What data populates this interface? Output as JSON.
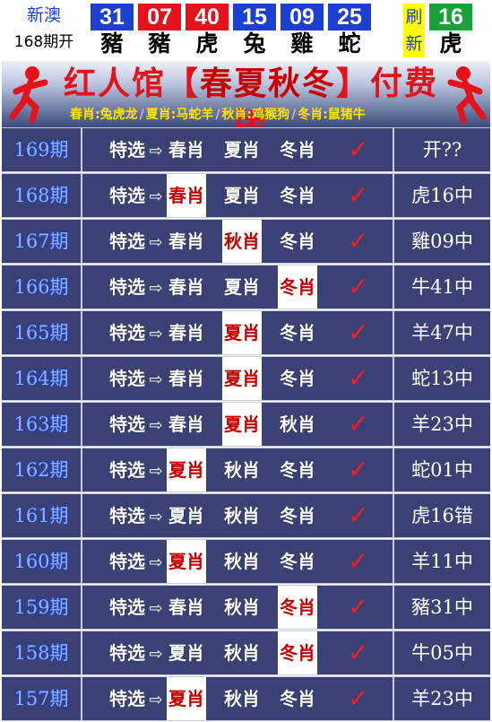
{
  "draw": {
    "lottery": "新澳",
    "period_label": "168期开",
    "refresh": [
      "刷",
      "新"
    ],
    "balls": [
      {
        "num": "31",
        "zodiac": "豬",
        "color": "#1d3fcf"
      },
      {
        "num": "07",
        "zodiac": "豬",
        "color": "#e3121b"
      },
      {
        "num": "40",
        "zodiac": "虎",
        "color": "#e3121b"
      },
      {
        "num": "15",
        "zodiac": "兔",
        "color": "#1d3fcf"
      },
      {
        "num": "09",
        "zodiac": "雞",
        "color": "#1d3fcf"
      },
      {
        "num": "25",
        "zodiac": "蛇",
        "color": "#1d3fcf"
      },
      {
        "num": "16",
        "zodiac": "虎",
        "color": "#18a238"
      }
    ]
  },
  "banner": {
    "title_pre": "红人馆【",
    "title_mid": "春夏秋冬",
    "title_post": "】付费版",
    "groups": [
      "春肖:兔虎龙",
      "夏肖:马蛇羊",
      "秋肖:鸡猴狗",
      "冬肖:鼠猪牛"
    ],
    "separator": "/"
  },
  "table": {
    "prefix": "特选",
    "arrow": "⇨",
    "check": "✓",
    "rows": [
      {
        "issue": "169期",
        "opts": [
          "春肖",
          "夏肖",
          "冬肖"
        ],
        "hit": -1,
        "result": "开??"
      },
      {
        "issue": "168期",
        "opts": [
          "春肖",
          "夏肖",
          "冬肖"
        ],
        "hit": 0,
        "result": "虎16中"
      },
      {
        "issue": "167期",
        "opts": [
          "春肖",
          "秋肖",
          "冬肖"
        ],
        "hit": 1,
        "result": "雞09中"
      },
      {
        "issue": "166期",
        "opts": [
          "春肖",
          "夏肖",
          "冬肖"
        ],
        "hit": 2,
        "result": "牛41中"
      },
      {
        "issue": "165期",
        "opts": [
          "春肖",
          "夏肖",
          "冬肖"
        ],
        "hit": 1,
        "result": "羊47中"
      },
      {
        "issue": "164期",
        "opts": [
          "春肖",
          "夏肖",
          "冬肖"
        ],
        "hit": 1,
        "result": "蛇13中"
      },
      {
        "issue": "163期",
        "opts": [
          "春肖",
          "夏肖",
          "秋肖"
        ],
        "hit": 1,
        "result": "羊23中"
      },
      {
        "issue": "162期",
        "opts": [
          "夏肖",
          "秋肖",
          "冬肖"
        ],
        "hit": 0,
        "result": "蛇01中"
      },
      {
        "issue": "161期",
        "opts": [
          "夏肖",
          "秋肖",
          "冬肖"
        ],
        "hit": -1,
        "result": "虎16错"
      },
      {
        "issue": "160期",
        "opts": [
          "夏肖",
          "秋肖",
          "冬肖"
        ],
        "hit": 0,
        "result": "羊11中"
      },
      {
        "issue": "159期",
        "opts": [
          "春肖",
          "秋肖",
          "冬肖"
        ],
        "hit": 2,
        "result": "豬31中"
      },
      {
        "issue": "158期",
        "opts": [
          "夏肖",
          "秋肖",
          "冬肖"
        ],
        "hit": 2,
        "result": "牛05中"
      },
      {
        "issue": "157期",
        "opts": [
          "夏肖",
          "秋肖",
          "冬肖"
        ],
        "hit": 0,
        "result": "羊23中"
      }
    ]
  },
  "colors": {
    "row_bg": "#3a4275",
    "hit_text": "#c40000",
    "check": "#ff1a1a",
    "banner_title": "#e3121b",
    "banner_sub": "#ffe400"
  }
}
